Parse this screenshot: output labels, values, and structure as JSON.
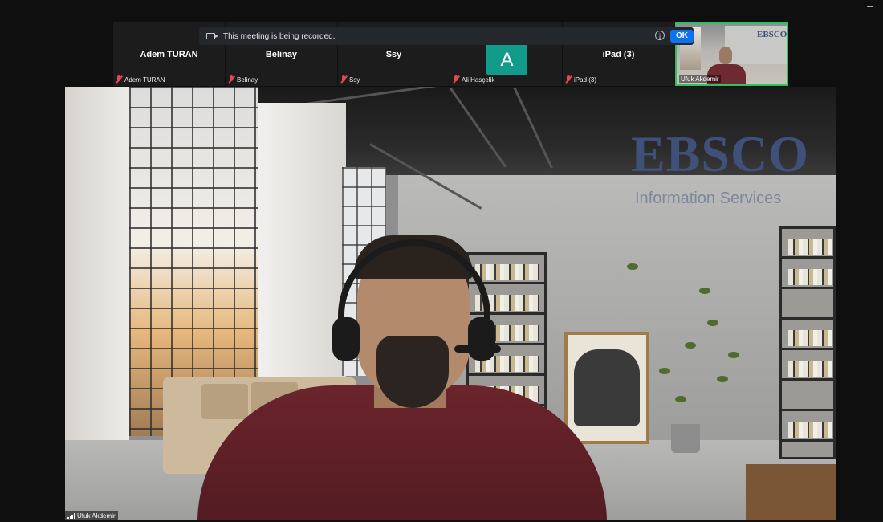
{
  "recording_banner": {
    "message": "This meeting is being recorded.",
    "ok_label": "OK",
    "info_icon": "i"
  },
  "participants": [
    {
      "display_name": "Adem TURAN",
      "label": "Adem TURAN",
      "muted": true
    },
    {
      "display_name": "Belinay",
      "label": "Belinay",
      "muted": true
    },
    {
      "display_name": "Ssy",
      "label": "Ssy",
      "muted": true
    },
    {
      "display_name": "A",
      "label": "Ali Hasçelik",
      "muted": true,
      "avatar_color": "#129a8b"
    },
    {
      "display_name": "iPad (3)",
      "label": "iPad (3)",
      "muted": true
    }
  ],
  "self_view": {
    "label": "Ufuk Akdemir",
    "backdrop_text": "EBSCO",
    "active_border_color": "#2ec265"
  },
  "main_speaker": {
    "label": "Ufuk Akdemir",
    "background_logo": "EBSCO",
    "background_tagline": "Information Services"
  },
  "window": {
    "minimize_glyph": "–"
  },
  "colors": {
    "accent_blue": "#0e72ed",
    "muted_red": "#e5484d",
    "banner_bg": "#24272c",
    "tile_bg": "#1c1c1c"
  }
}
